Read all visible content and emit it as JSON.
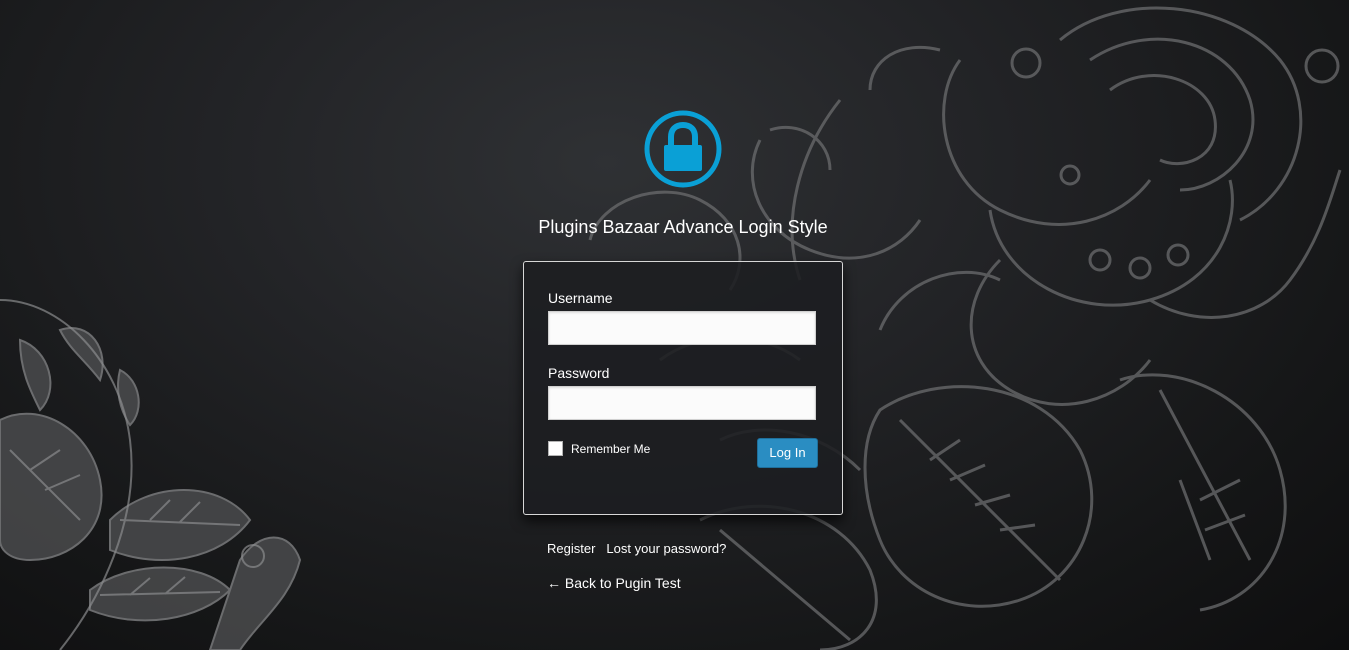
{
  "site_title": "Plugins Bazaar Advance Login Style",
  "form": {
    "username_label": "Username",
    "username_value": "",
    "password_label": "Password",
    "password_value": "",
    "remember_label": "Remember Me",
    "remember_checked": false,
    "login_button": "Log In"
  },
  "links": {
    "register": "Register",
    "lost_password": "Lost your password?",
    "back_to_site": "← Back to Pugin Test"
  },
  "icons": {
    "logo": "lock-icon"
  },
  "colors": {
    "accent": "#0aa0d6",
    "button": "#2a8dc2",
    "background": "#1e1f21"
  }
}
